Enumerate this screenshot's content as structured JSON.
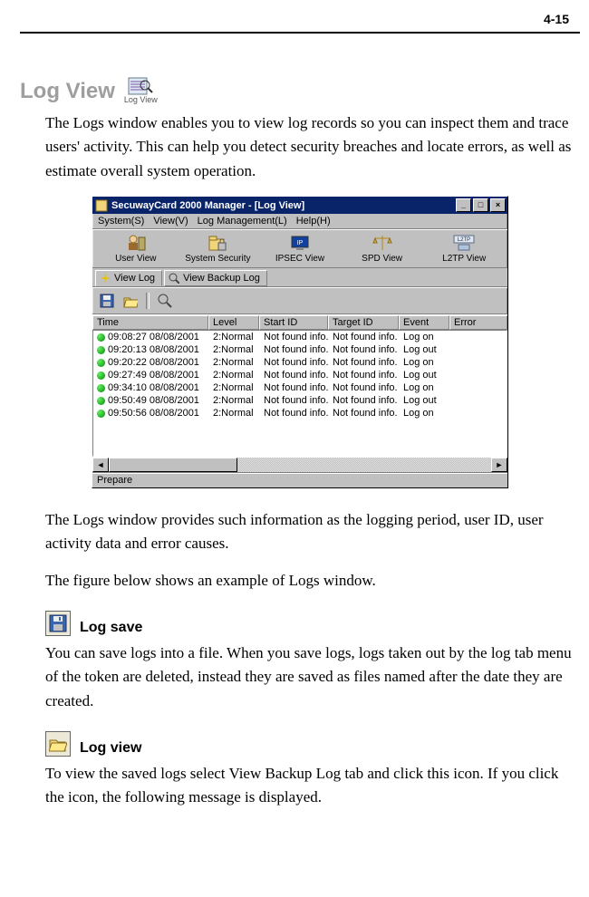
{
  "page_number": "4-15",
  "heading": "Log View",
  "heading_icon_caption": "Log View",
  "intro_para": "The Logs window enables you to view log records so you can inspect them and trace users' activity. This can help you detect security breaches and locate errors, as well as estimate overall system operation.",
  "after_shot_para1": "The Logs window provides such information as the logging period, user ID, user activity data and error causes.",
  "after_shot_para2": "The figure below shows an example of Logs window.",
  "log_save": {
    "title": "Log save",
    "body": "You can save logs into a file. When you save logs, logs taken out by the log tab menu of the token are deleted, instead they are saved as files named after the date they are created."
  },
  "log_view": {
    "title": "Log view",
    "body": "To view the saved logs select View Backup Log tab and click this icon. If you click the icon, the following message is displayed."
  },
  "window": {
    "title": "SecuwayCard 2000 Manager - [Log View]",
    "menus": [
      "System(S)",
      "View(V)",
      "Log Management(L)",
      "Help(H)"
    ],
    "toolbar": [
      "User View",
      "System Security",
      "IPSEC View",
      "SPD View",
      "L2TP View"
    ],
    "tabs": {
      "view_log": "View Log",
      "view_backup_log": "View Backup Log"
    },
    "columns": [
      "Time",
      "Level",
      "Start ID",
      "Target ID",
      "Event",
      "Error"
    ],
    "rows": [
      {
        "time": "09:08:27 08/08/2001",
        "level": "2:Normal",
        "start": "Not found info.",
        "target": "Not found info.",
        "event": "Log on"
      },
      {
        "time": "09:20:13 08/08/2001",
        "level": "2:Normal",
        "start": "Not found info.",
        "target": "Not found info.",
        "event": "Log out"
      },
      {
        "time": "09:20:22 08/08/2001",
        "level": "2:Normal",
        "start": "Not found info.",
        "target": "Not found info.",
        "event": "Log on"
      },
      {
        "time": "09:27:49 08/08/2001",
        "level": "2:Normal",
        "start": "Not found info.",
        "target": "Not found info.",
        "event": "Log out"
      },
      {
        "time": "09:34:10 08/08/2001",
        "level": "2:Normal",
        "start": "Not found info.",
        "target": "Not found info.",
        "event": "Log on"
      },
      {
        "time": "09:50:49 08/08/2001",
        "level": "2:Normal",
        "start": "Not found info.",
        "target": "Not found info.",
        "event": "Log out"
      },
      {
        "time": "09:50:56 08/08/2001",
        "level": "2:Normal",
        "start": "Not found info.",
        "target": "Not found info.",
        "event": "Log on"
      }
    ],
    "status": "Prepare"
  }
}
